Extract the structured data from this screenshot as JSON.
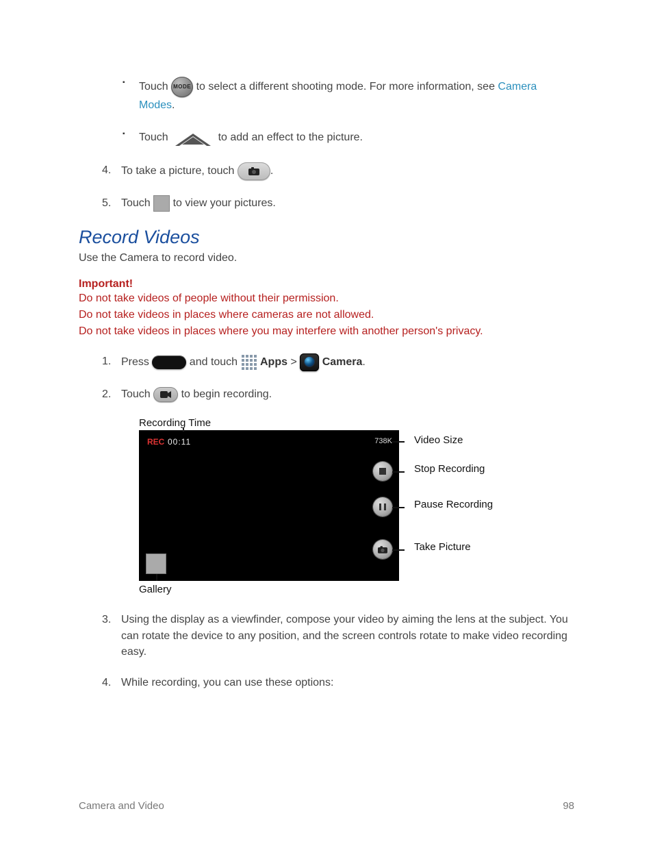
{
  "icons": {
    "mode_text": "MODE"
  },
  "bullets": {
    "b1": {
      "pre": "Touch ",
      "post": " to select a different shooting mode. For more information, see ",
      "link": "Camera Modes",
      "trail": "."
    },
    "b2": {
      "pre": "Touch ",
      "post": " to add an effect to the picture."
    }
  },
  "steps_a": {
    "s4": {
      "pre": "To take a picture, touch ",
      "post": "."
    },
    "s5": {
      "pre": "Touch ",
      "post": " to view your pictures."
    }
  },
  "section": {
    "heading": "Record Videos",
    "intro": "Use the Camera to record video."
  },
  "important": {
    "title": "Important!",
    "l1": "Do not take videos of people without their permission.",
    "l2": "Do not take videos in places where cameras are not allowed.",
    "l3": "Do not take videos in places where you may interfere with another person's privacy."
  },
  "steps_b": {
    "s1": {
      "pre": "Press ",
      "mid1": " and touch ",
      "apps": "Apps",
      "gt": " > ",
      "camera": "Camera",
      "post": "."
    },
    "s2": {
      "pre": "Touch ",
      "post": " to begin recording."
    },
    "s3": "Using the display as a viewfinder, compose your video by aiming the lens at the subject. You can rotate the device to any position, and the screen controls rotate to make video recording easy.",
    "s4": "While recording, you can use these options:"
  },
  "diagram": {
    "caption_rectime": "Recording Time",
    "rec_label": "REC",
    "rec_time": "00:11",
    "rec_size_text": "738K",
    "label_video_size": "Video Size",
    "label_stop": "Stop Recording",
    "label_pause": "Pause Recording",
    "label_take": "Take Picture",
    "caption_gallery": "Gallery"
  },
  "footer": {
    "left": "Camera and Video",
    "right": "98"
  }
}
